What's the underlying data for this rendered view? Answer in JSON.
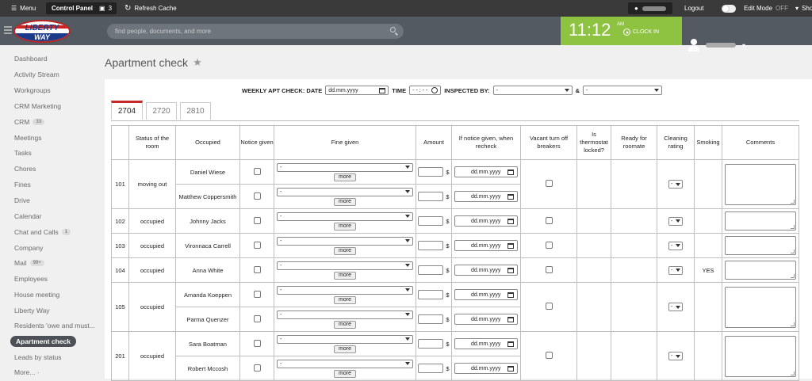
{
  "topbar": {
    "menu_label": "Menu",
    "control_panel_label": "Control Panel",
    "badge_count": "3",
    "refresh_label": "Refresh Cache",
    "logout_label": "Logout",
    "edit_mode_label": "Edit Mode",
    "edit_mode_state": "OFF",
    "show_label": "Show"
  },
  "header": {
    "logo_line1": "LIBERTY",
    "logo_line2": "WAY",
    "search_placeholder": "find people, documents, and more",
    "time": "11:12",
    "ampm": "AM",
    "clock_in_label": "CLOCK IN"
  },
  "sidebar": {
    "items": [
      {
        "label": "Dashboard"
      },
      {
        "label": "Activity Stream"
      },
      {
        "label": "Workgroups"
      },
      {
        "label": "CRM Marketing"
      },
      {
        "label": "CRM",
        "badge": "33"
      },
      {
        "label": "Meetings"
      },
      {
        "label": "Tasks"
      },
      {
        "label": "Chores"
      },
      {
        "label": "Fines"
      },
      {
        "label": "Drive"
      },
      {
        "label": "Calendar"
      },
      {
        "label": "Chat and Calls",
        "badge": "1"
      },
      {
        "label": "Company"
      },
      {
        "label": "Mail",
        "badge": "99+"
      },
      {
        "label": "Employees"
      },
      {
        "label": "House meeting"
      },
      {
        "label": "Liberty Way"
      },
      {
        "label": "Residents 'owe and must..."
      },
      {
        "label": "Apartment check"
      },
      {
        "label": "Leads by status"
      },
      {
        "label": "More... ·"
      }
    ]
  },
  "page": {
    "title": "Apartment check",
    "filters": {
      "label": "WEEKLY APT CHECK: DATE",
      "date_placeholder": "dd.mm.yyyy",
      "time_label": "TIME",
      "time_placeholder": "- - : - -",
      "inspected_label": "INSPECTED BY:",
      "inspector1": "-",
      "amp": "&",
      "inspector2": "-"
    },
    "tabs": [
      "2704",
      "2720",
      "2810"
    ],
    "columns": [
      "Status of the room",
      "Occupied",
      "Notice given",
      "Fine given",
      "Amount",
      "If notice given, when recheck",
      "Vacant turn off breakers",
      "Is thermostat locked?",
      "Ready for roomate",
      "Cleaning rating",
      "Smoking",
      "Comments"
    ],
    "fine_default": "-",
    "more_label": "more",
    "currency": "$",
    "date_placeholder": "dd.mm.yyyy",
    "rating_default": "-",
    "rows": [
      {
        "room": "101",
        "status": "moving out",
        "smoking": "",
        "occupants": [
          "Daniel Wiese",
          "Matthew Coppersmith"
        ]
      },
      {
        "room": "102",
        "status": "occupied",
        "smoking": "",
        "occupants": [
          "Johnny Jacks"
        ]
      },
      {
        "room": "103",
        "status": "occupied",
        "smoking": "",
        "occupants": [
          "Vironnaca Carrell"
        ]
      },
      {
        "room": "104",
        "status": "occupied",
        "smoking": "YES",
        "occupants": [
          "Anna White"
        ]
      },
      {
        "room": "105",
        "status": "occupied",
        "smoking": "",
        "occupants": [
          "Amanda Koeppen",
          "Parma Quenzer"
        ]
      },
      {
        "room": "201",
        "status": "occupied",
        "smoking": "",
        "occupants": [
          "Sara Boatman",
          "Robert Mccosh"
        ]
      }
    ]
  }
}
